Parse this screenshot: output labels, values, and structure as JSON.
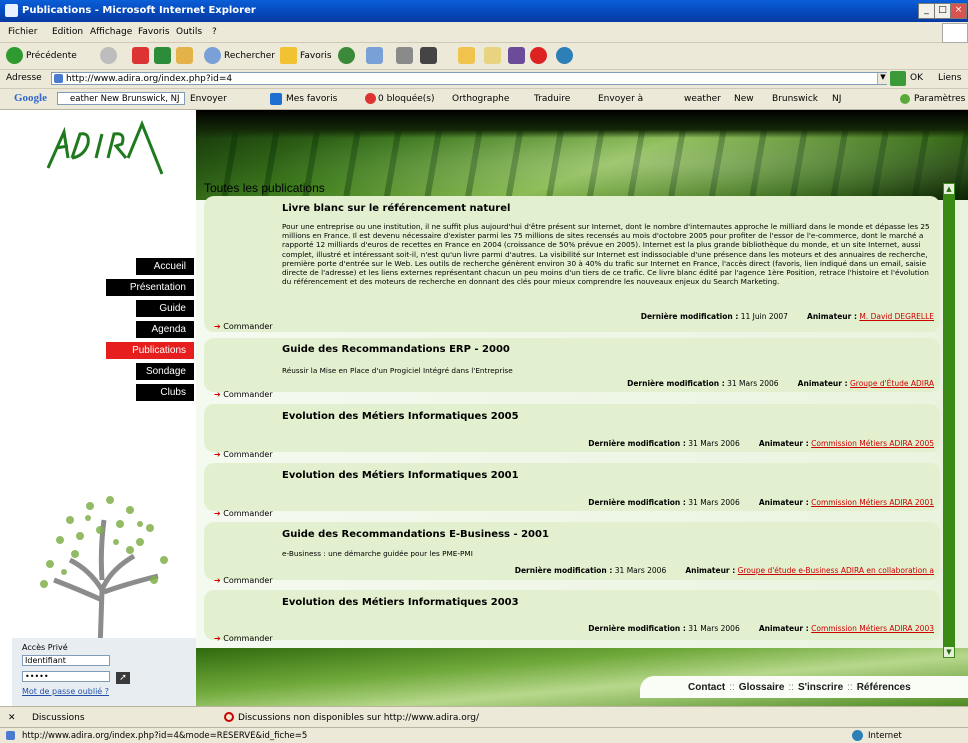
{
  "browser": {
    "title": "Publications - Microsoft Internet Explorer",
    "menu": [
      "Fichier",
      "Edition",
      "Affichage",
      "Favoris",
      "Outils",
      "?"
    ],
    "toolbar": {
      "back": "Précédente",
      "search": "Rechercher",
      "favorites": "Favoris"
    },
    "address_label": "Adresse",
    "address": "http://www.adira.org/index.php?id=4",
    "go": "OK",
    "links": "Liens",
    "google": {
      "logo": "Google",
      "search_value": "eather New Brunswick, NJ",
      "envoyer": "Envoyer",
      "mes_favoris": "Mes favoris",
      "blocked": "0 bloquée(s)",
      "orthographe": "Orthographe",
      "traduire": "Traduire",
      "envoyer_a": "Envoyer à",
      "weather": "weather",
      "new": "New",
      "brunswick": "Brunswick",
      "nj": "NJ",
      "parametres": "Paramètres"
    },
    "discussions": {
      "label": "Discussions",
      "status": "Discussions non disponibles sur http://www.adira.org/"
    },
    "status": {
      "url": "http://www.adira.org/index.php?id=4&mode=RESERVE&id_fiche=5",
      "zone": "Internet"
    }
  },
  "site": {
    "logo": "ADIRA",
    "nav": [
      "Accueil",
      "Présentation",
      "Guide",
      "Agenda",
      "Publications",
      "Sondage",
      "Clubs"
    ],
    "active_nav": "Publications",
    "login": {
      "title": "Accès Privé",
      "user_value": "Identifiant",
      "pass_value": "•••••",
      "forgot": "Mot de passe oublié ?"
    },
    "section_title": "Toutes les publications",
    "meta_label": "Dernière modification :",
    "animator_label": "Animateur :",
    "order_label": "Commander",
    "publications": [
      {
        "title": "Livre blanc sur le référencement naturel",
        "description": "Pour une entreprise ou une institution, il ne suffit plus aujourd'hui d'être présent sur Internet, dont le nombre d'internautes approche le milliard dans le monde et dépasse les 25 millions en France. Il est devenu nécessaire d'exister parmi les 75 millions de sites recensés au mois d'octobre 2005 pour profiter de l'essor de l'e-commerce, dont le marché a rapporté 12 milliards d'euros de recettes en France en 2004 (croissance de 50% prévue en 2005). Internet est la plus grande bibliothèque du monde, et un site Internet, aussi complet, illustré et intéressant soit-il, n'est qu'un livre parmi d'autres. La visibilité sur Internet est indissociable d'une présence dans les moteurs et des annuaires de recherche, première porte d'entrée sur le Web. Les outils de recherche génèrent environ 30 à 40% du trafic sur Internet en France, l'accès direct (favoris, lien indiqué dans un email, saisie directe de l'adresse) et les liens externes représentant chacun un peu moins d'un tiers de ce trafic. Ce livre blanc édité par l'agence 1ère Position, retrace l'histoire et l'évolution du référencement et des moteurs de recherche en donnant des clés pour mieux comprendre les nouveaux enjeux du Search Marketing.",
        "date": "11 Juin 2007",
        "animator": "M. David DEGRELLE"
      },
      {
        "title": "Guide des Recommandations ERP - 2000",
        "description": "Réussir la Mise en Place d'un Progiciel Intégré dans l'Entreprise",
        "date": "31 Mars 2006",
        "animator": "Groupe d'Étude ADIRA"
      },
      {
        "title": "Evolution des Métiers Informatiques 2005",
        "description": "",
        "date": "31 Mars 2006",
        "animator": "Commission Métiers ADIRA 2005"
      },
      {
        "title": "Evolution des Métiers Informatiques 2001",
        "description": "",
        "date": "31 Mars 2006",
        "animator": "Commission Métiers ADIRA 2001"
      },
      {
        "title": "Guide des Recommandations E-Business - 2001",
        "description": "e-Business : une démarche guidée pour les PME-PMI",
        "date": "31 Mars 2006",
        "animator": "Groupe d'étude e-Business ADIRA en collaboration a"
      },
      {
        "title": "Evolution des Métiers Informatiques 2003",
        "description": "",
        "date": "31 Mars 2006",
        "animator": "Commission Métiers ADIRA 2003"
      }
    ],
    "footer": [
      "Contact",
      "Glossaire",
      "S'inscrire",
      "Références"
    ],
    "footer_sep": "::"
  }
}
